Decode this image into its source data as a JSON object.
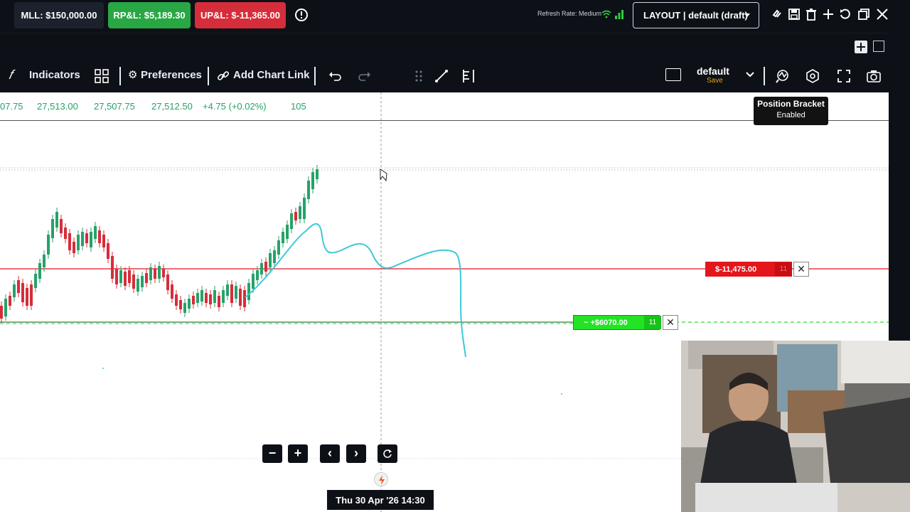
{
  "account_bar": {
    "mll": "MLL: $150,000.00",
    "rpl": "RP&L: $5,189.30",
    "upl": "UP&L: $-11,365.00",
    "refresh_rate": "Refresh Rate: Medium",
    "layout": "LAYOUT | default (draft)",
    "colors": {
      "rpl": "#29a745",
      "upl": "#d62d3a"
    },
    "icons": [
      "info-icon",
      "wifi-icon",
      "signal-bars-icon",
      "chevron-down-icon",
      "link-icon",
      "save-icon",
      "trash-icon",
      "plus-icon",
      "undo-icon",
      "restore-window-icon",
      "expand-icon"
    ]
  },
  "toolbar": {
    "indicators": "Indicators",
    "preferences": "Preferences",
    "add_chart_link": "Add Chart Link",
    "layout_name": "default",
    "save": "Save"
  },
  "ohlc": {
    "items": [
      "07.75",
      "27,513.00",
      "27,507.75",
      "27,512.50",
      "+4.75 (+0.02%)",
      "105"
    ]
  },
  "position_bracket": {
    "title": "Position Bracket",
    "status": "Enabled"
  },
  "orders": {
    "stop_loss": {
      "label": "$-11,475.00",
      "qty": "11",
      "color": "#e3161b"
    },
    "take_profit": {
      "label": "~ +$6070.00",
      "qty": "11",
      "color": "#22e324"
    }
  },
  "chart_nav": {
    "zoom_out": "−",
    "zoom_in": "+",
    "prev": "‹",
    "next": "›"
  },
  "crosshair_date": "Thu 30 Apr '26   14:30"
}
